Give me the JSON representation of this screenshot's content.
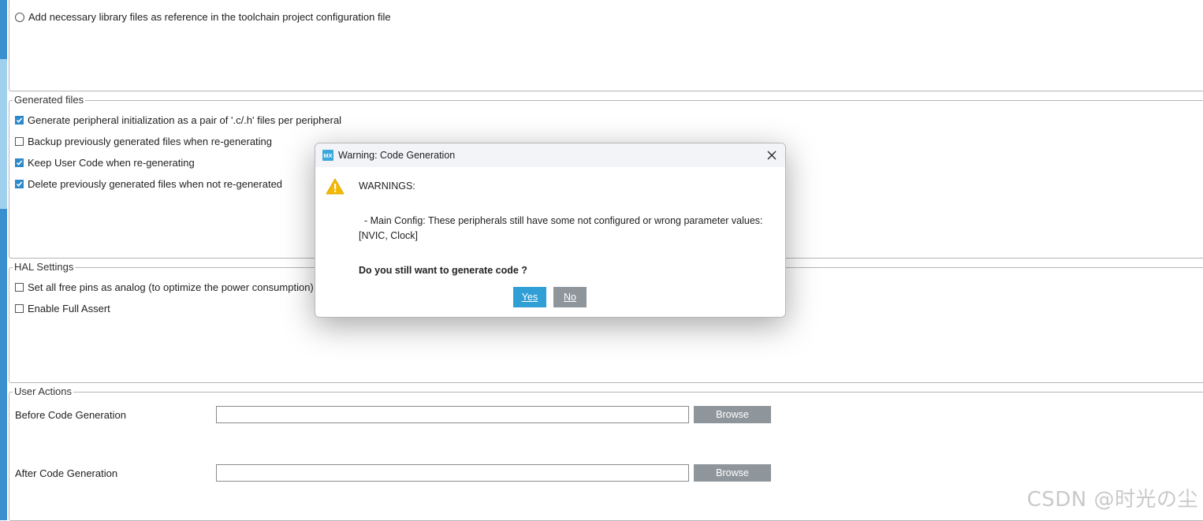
{
  "project_options": {
    "radio_add_library_label": "Add necessary library files as reference in the toolchain project configuration file"
  },
  "generated_files": {
    "title": "Generated files",
    "items": [
      {
        "label": "Generate peripheral initialization as a pair of '.c/.h' files per peripheral",
        "checked": true
      },
      {
        "label": "Backup previously generated files when re-generating",
        "checked": false
      },
      {
        "label": "Keep User Code when re-generating",
        "checked": true
      },
      {
        "label": "Delete previously generated files when not re-generated",
        "checked": true
      }
    ]
  },
  "hal_settings": {
    "title": "HAL Settings",
    "items": [
      {
        "label": "Set all free pins as analog (to optimize the power consumption)",
        "checked": false
      },
      {
        "label": "Enable Full Assert",
        "checked": false
      }
    ]
  },
  "user_actions": {
    "title": "User Actions",
    "before_label": "Before Code Generation",
    "after_label": "After Code Generation",
    "before_value": "",
    "after_value": "",
    "browse_label": "Browse"
  },
  "dialog": {
    "title": "Warning: Code Generation",
    "logo_text": "MX",
    "heading": "WARNINGS:",
    "message_line1": "  - Main Config: These peripherals still have some not configured or wrong parameter values:",
    "message_line2": "[NVIC, Clock]",
    "question": "Do you still want to generate code ?",
    "yes_label": "Yes",
    "no_label": "No"
  },
  "watermark": "CSDN @时光の尘",
  "colors": {
    "accent": "#2f9fd6",
    "checkbox_checked": "#2d89c8",
    "button_gray": "#8e969c",
    "warning": "#f5b800"
  }
}
